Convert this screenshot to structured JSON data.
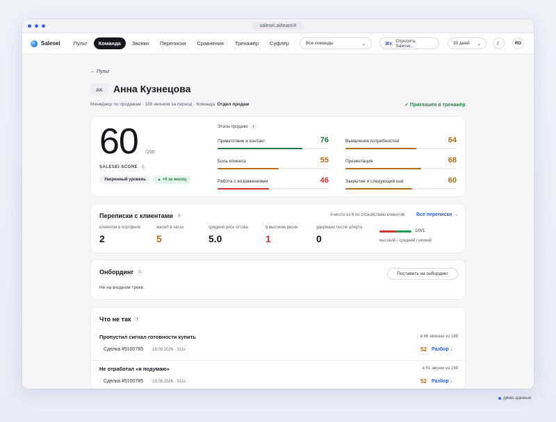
{
  "browser": {
    "url": "salesei.ai/team/4"
  },
  "nav": {
    "brand": "Salesei",
    "items": [
      "Пульт",
      "Команда",
      "Звонки",
      "Переписки",
      "Сравнения",
      "Тренажёр",
      "Суфлёр"
    ],
    "active_index": 1,
    "team_select": "Все команды",
    "ask_kbd": "⌘K",
    "ask_label": "Спросить Salesei…",
    "period_select": "30 дней",
    "theme_icon": "moon-icon",
    "user_initials": "RO"
  },
  "page": {
    "back_link": "← Пульт",
    "initials": "AK",
    "name": "Анна Кузнецова",
    "meta_prefix": "Менеджер по продажам · 189 звонков за период · Команда: ",
    "meta_team": "Отдел продаж",
    "invited": "Приглашён в тренажёр"
  },
  "score": {
    "value": "60",
    "max": "/100",
    "label": "SALESEI SCORE",
    "level_chip": "Уверенный уровень",
    "delta_chip": "▲ +9 за месяц"
  },
  "stages": {
    "title": "Этапы продажи",
    "items": [
      {
        "name": "Приветствие и контакт",
        "value": "76",
        "fraction": 0.76,
        "color": "#1f7a46"
      },
      {
        "name": "Выявление потребностей",
        "value": "64",
        "fraction": 0.64,
        "color": "#b06b14"
      },
      {
        "name": "Боль клиента",
        "value": "55",
        "fraction": 0.55,
        "color": "#b06b14"
      },
      {
        "name": "Презентация",
        "value": "68",
        "fraction": 0.68,
        "color": "#b06b14"
      },
      {
        "name": "Работа с возражениями",
        "value": "46",
        "fraction": 0.46,
        "color": "#d0312d"
      },
      {
        "name": "Закрытие и следующий шаг",
        "value": "60",
        "fraction": 0.6,
        "color": "#b06b14"
      }
    ]
  },
  "chats": {
    "title": "Переписки с клиентами",
    "rank": "4 место из 6 по спокойствию клиентов",
    "all_link": "Все переписки →",
    "metrics": [
      {
        "label": "клиентов в портфеле",
        "value": "2",
        "color": "#15161b"
      },
      {
        "label": "жалоб в чатах",
        "value": "5",
        "color": "#b06b14"
      },
      {
        "label": "средний риск оттока",
        "value": "5.0",
        "color": "#15161b"
      },
      {
        "label": "в высоком риске",
        "value": "1",
        "color": "#d0312d"
      },
      {
        "label": "удержано после алерта",
        "value": "0",
        "color": "#15161b"
      }
    ],
    "risk_counts": "1/0/1",
    "risk_legend": "высокий / средний / низкий",
    "risk_split": [
      {
        "fraction": 0.5,
        "color": "#d0312d"
      },
      {
        "fraction": 0.5,
        "color": "#1f9a55"
      }
    ]
  },
  "onboarding": {
    "title": "Онбординг",
    "button": "Поставить на онбординг",
    "text": "Не на входном треке."
  },
  "issues": {
    "title": "Что не так",
    "items": [
      {
        "title": "Пропустил сигнал готовности купить",
        "count": "в 66 звонках из 189",
        "deal": "Сделка #5100785",
        "meta": "19.09.2026 · 311s",
        "score": "52",
        "link": "Разбор ↓"
      },
      {
        "title": "Не отработал «я подумаю»",
        "count": "в 51 звонке из 189",
        "deal": "Сделка #5100785",
        "meta": "19.09.2026 · 311s",
        "score": "52",
        "link": "Разбор ↓"
      }
    ]
  },
  "footer": {
    "demo": "демо-данные"
  }
}
